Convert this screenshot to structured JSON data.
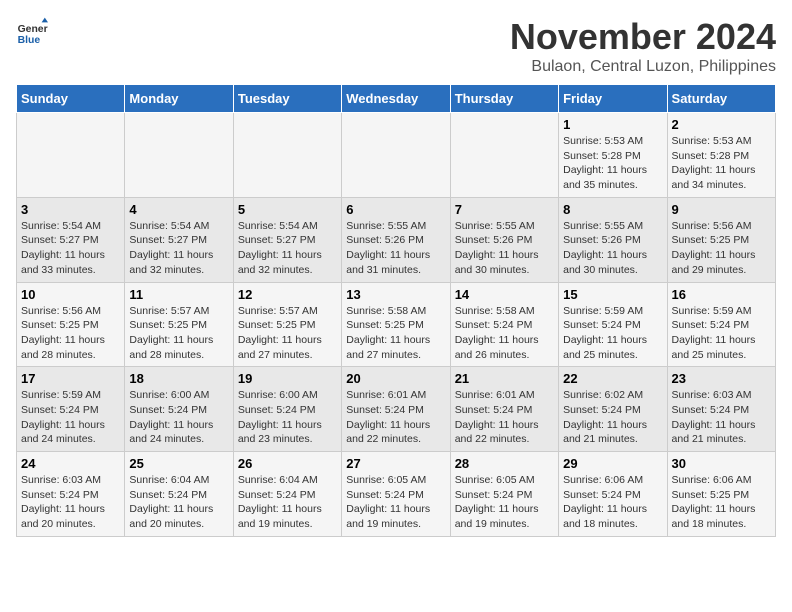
{
  "logo": {
    "general": "General",
    "blue": "Blue"
  },
  "title": "November 2024",
  "location": "Bulaon, Central Luzon, Philippines",
  "days_of_week": [
    "Sunday",
    "Monday",
    "Tuesday",
    "Wednesday",
    "Thursday",
    "Friday",
    "Saturday"
  ],
  "weeks": [
    [
      {
        "day": "",
        "info": ""
      },
      {
        "day": "",
        "info": ""
      },
      {
        "day": "",
        "info": ""
      },
      {
        "day": "",
        "info": ""
      },
      {
        "day": "",
        "info": ""
      },
      {
        "day": "1",
        "info": "Sunrise: 5:53 AM\nSunset: 5:28 PM\nDaylight: 11 hours and 35 minutes."
      },
      {
        "day": "2",
        "info": "Sunrise: 5:53 AM\nSunset: 5:28 PM\nDaylight: 11 hours and 34 minutes."
      }
    ],
    [
      {
        "day": "3",
        "info": "Sunrise: 5:54 AM\nSunset: 5:27 PM\nDaylight: 11 hours and 33 minutes."
      },
      {
        "day": "4",
        "info": "Sunrise: 5:54 AM\nSunset: 5:27 PM\nDaylight: 11 hours and 32 minutes."
      },
      {
        "day": "5",
        "info": "Sunrise: 5:54 AM\nSunset: 5:27 PM\nDaylight: 11 hours and 32 minutes."
      },
      {
        "day": "6",
        "info": "Sunrise: 5:55 AM\nSunset: 5:26 PM\nDaylight: 11 hours and 31 minutes."
      },
      {
        "day": "7",
        "info": "Sunrise: 5:55 AM\nSunset: 5:26 PM\nDaylight: 11 hours and 30 minutes."
      },
      {
        "day": "8",
        "info": "Sunrise: 5:55 AM\nSunset: 5:26 PM\nDaylight: 11 hours and 30 minutes."
      },
      {
        "day": "9",
        "info": "Sunrise: 5:56 AM\nSunset: 5:25 PM\nDaylight: 11 hours and 29 minutes."
      }
    ],
    [
      {
        "day": "10",
        "info": "Sunrise: 5:56 AM\nSunset: 5:25 PM\nDaylight: 11 hours and 28 minutes."
      },
      {
        "day": "11",
        "info": "Sunrise: 5:57 AM\nSunset: 5:25 PM\nDaylight: 11 hours and 28 minutes."
      },
      {
        "day": "12",
        "info": "Sunrise: 5:57 AM\nSunset: 5:25 PM\nDaylight: 11 hours and 27 minutes."
      },
      {
        "day": "13",
        "info": "Sunrise: 5:58 AM\nSunset: 5:25 PM\nDaylight: 11 hours and 27 minutes."
      },
      {
        "day": "14",
        "info": "Sunrise: 5:58 AM\nSunset: 5:24 PM\nDaylight: 11 hours and 26 minutes."
      },
      {
        "day": "15",
        "info": "Sunrise: 5:59 AM\nSunset: 5:24 PM\nDaylight: 11 hours and 25 minutes."
      },
      {
        "day": "16",
        "info": "Sunrise: 5:59 AM\nSunset: 5:24 PM\nDaylight: 11 hours and 25 minutes."
      }
    ],
    [
      {
        "day": "17",
        "info": "Sunrise: 5:59 AM\nSunset: 5:24 PM\nDaylight: 11 hours and 24 minutes."
      },
      {
        "day": "18",
        "info": "Sunrise: 6:00 AM\nSunset: 5:24 PM\nDaylight: 11 hours and 24 minutes."
      },
      {
        "day": "19",
        "info": "Sunrise: 6:00 AM\nSunset: 5:24 PM\nDaylight: 11 hours and 23 minutes."
      },
      {
        "day": "20",
        "info": "Sunrise: 6:01 AM\nSunset: 5:24 PM\nDaylight: 11 hours and 22 minutes."
      },
      {
        "day": "21",
        "info": "Sunrise: 6:01 AM\nSunset: 5:24 PM\nDaylight: 11 hours and 22 minutes."
      },
      {
        "day": "22",
        "info": "Sunrise: 6:02 AM\nSunset: 5:24 PM\nDaylight: 11 hours and 21 minutes."
      },
      {
        "day": "23",
        "info": "Sunrise: 6:03 AM\nSunset: 5:24 PM\nDaylight: 11 hours and 21 minutes."
      }
    ],
    [
      {
        "day": "24",
        "info": "Sunrise: 6:03 AM\nSunset: 5:24 PM\nDaylight: 11 hours and 20 minutes."
      },
      {
        "day": "25",
        "info": "Sunrise: 6:04 AM\nSunset: 5:24 PM\nDaylight: 11 hours and 20 minutes."
      },
      {
        "day": "26",
        "info": "Sunrise: 6:04 AM\nSunset: 5:24 PM\nDaylight: 11 hours and 19 minutes."
      },
      {
        "day": "27",
        "info": "Sunrise: 6:05 AM\nSunset: 5:24 PM\nDaylight: 11 hours and 19 minutes."
      },
      {
        "day": "28",
        "info": "Sunrise: 6:05 AM\nSunset: 5:24 PM\nDaylight: 11 hours and 19 minutes."
      },
      {
        "day": "29",
        "info": "Sunrise: 6:06 AM\nSunset: 5:24 PM\nDaylight: 11 hours and 18 minutes."
      },
      {
        "day": "30",
        "info": "Sunrise: 6:06 AM\nSunset: 5:25 PM\nDaylight: 11 hours and 18 minutes."
      }
    ]
  ]
}
